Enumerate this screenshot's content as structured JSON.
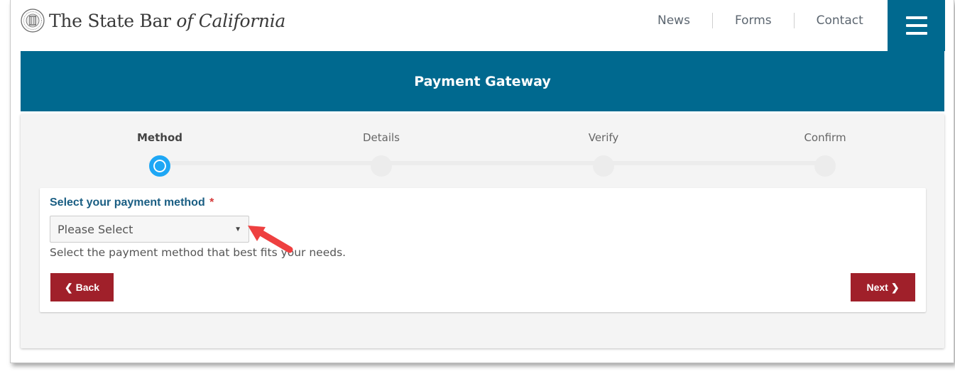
{
  "header": {
    "logo": {
      "text_main": "The State Bar ",
      "text_italic": "of California"
    },
    "nav": [
      {
        "label": "News"
      },
      {
        "label": "Forms"
      },
      {
        "label": "Contact"
      }
    ],
    "menu_icon": "hamburger-icon"
  },
  "banner": {
    "title": "Payment Gateway"
  },
  "stepper": {
    "steps": [
      {
        "label": "Method",
        "active": true
      },
      {
        "label": "Details",
        "active": false
      },
      {
        "label": "Verify",
        "active": false
      },
      {
        "label": "Confirm",
        "active": false
      }
    ]
  },
  "form": {
    "label": "Select your payment method",
    "required_marker": "*",
    "select_value": "Please Select",
    "help_text": "Select the payment method that best fits your needs."
  },
  "buttons": {
    "back": "Back",
    "next": "Next"
  },
  "colors": {
    "brand_blue": "#00698f",
    "step_active": "#1ea7f5",
    "button_red": "#a0202a",
    "label_blue": "#1a5e83",
    "annotation_arrow": "#ee4040"
  }
}
